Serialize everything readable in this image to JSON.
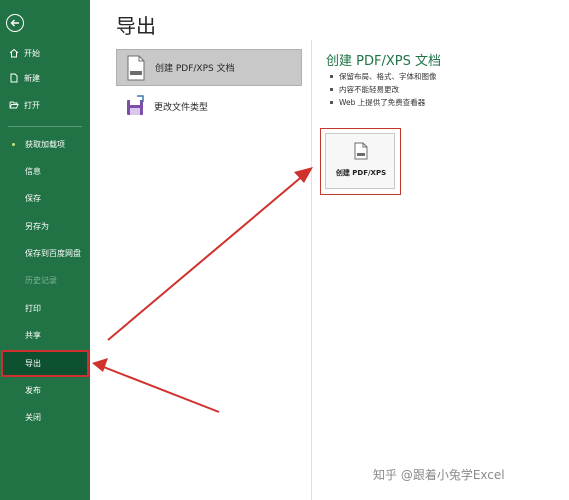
{
  "page_title": "导出",
  "sidebar": {
    "items": [
      {
        "label": "开始"
      },
      {
        "label": "新建"
      },
      {
        "label": "打开"
      },
      {
        "label": "获取加载项"
      },
      {
        "label": "信息"
      },
      {
        "label": "保存"
      },
      {
        "label": "另存为"
      },
      {
        "label": "保存到百度网盘"
      },
      {
        "label": "历史记录"
      },
      {
        "label": "打印"
      },
      {
        "label": "共享"
      },
      {
        "label": "导出"
      },
      {
        "label": "发布"
      },
      {
        "label": "关闭"
      }
    ]
  },
  "export_options": [
    {
      "label": "创建 PDF/XPS 文档"
    },
    {
      "label": "更改文件类型"
    }
  ],
  "detail": {
    "title": "创建 PDF/XPS 文档",
    "bullets": [
      "保留布局、格式、字体和图像",
      "内容不能轻易更改",
      "Web 上提供了免费查看器"
    ],
    "button_label": "创建 PDF/XPS"
  },
  "watermark": "知乎 @跟着小兔学Excel",
  "colors": {
    "sidebar": "#217346",
    "selected": "#0e5130",
    "highlight": "#d02f2f",
    "accent": "#217346"
  }
}
